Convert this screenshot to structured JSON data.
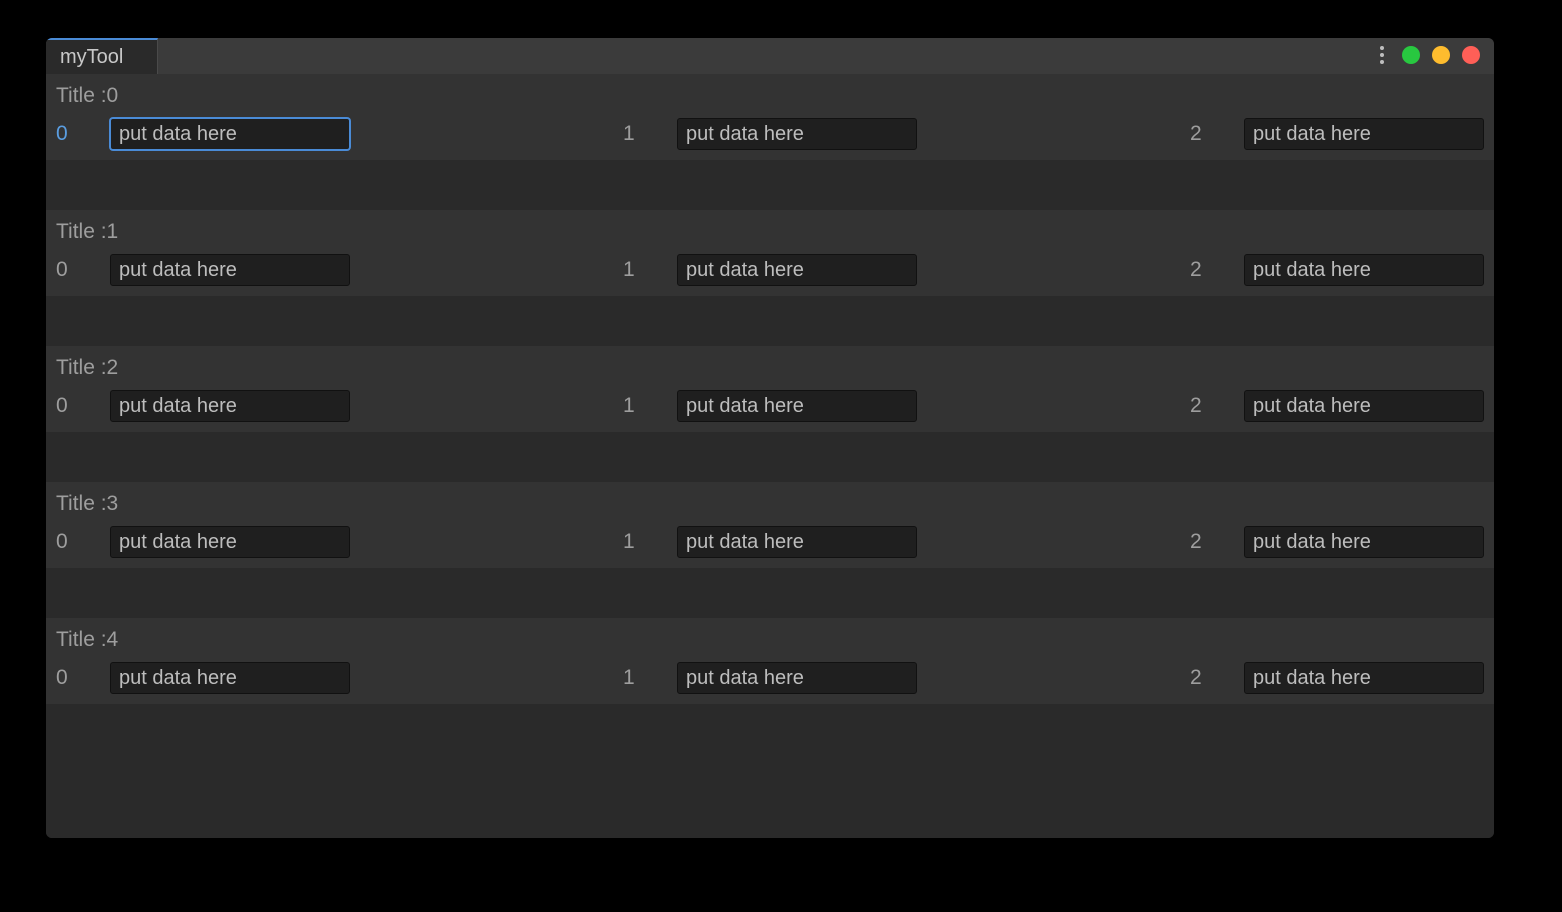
{
  "window": {
    "tab_label": "myTool"
  },
  "blocks": [
    {
      "title": "Title :0",
      "fields": [
        {
          "label": "0",
          "placeholder": "put data here",
          "value": "",
          "focused": true
        },
        {
          "label": "1",
          "placeholder": "put data here",
          "value": ""
        },
        {
          "label": "2",
          "placeholder": "put data here",
          "value": ""
        }
      ]
    },
    {
      "title": "Title :1",
      "fields": [
        {
          "label": "0",
          "placeholder": "put data here",
          "value": ""
        },
        {
          "label": "1",
          "placeholder": "put data here",
          "value": ""
        },
        {
          "label": "2",
          "placeholder": "put data here",
          "value": ""
        }
      ]
    },
    {
      "title": "Title :2",
      "fields": [
        {
          "label": "0",
          "placeholder": "put data here",
          "value": ""
        },
        {
          "label": "1",
          "placeholder": "put data here",
          "value": ""
        },
        {
          "label": "2",
          "placeholder": "put data here",
          "value": ""
        }
      ]
    },
    {
      "title": "Title :3",
      "fields": [
        {
          "label": "0",
          "placeholder": "put data here",
          "value": ""
        },
        {
          "label": "1",
          "placeholder": "put data here",
          "value": ""
        },
        {
          "label": "2",
          "placeholder": "put data here",
          "value": ""
        }
      ]
    },
    {
      "title": "Title :4",
      "fields": [
        {
          "label": "0",
          "placeholder": "put data here",
          "value": ""
        },
        {
          "label": "1",
          "placeholder": "put data here",
          "value": ""
        },
        {
          "label": "2",
          "placeholder": "put data here",
          "value": ""
        }
      ]
    }
  ]
}
